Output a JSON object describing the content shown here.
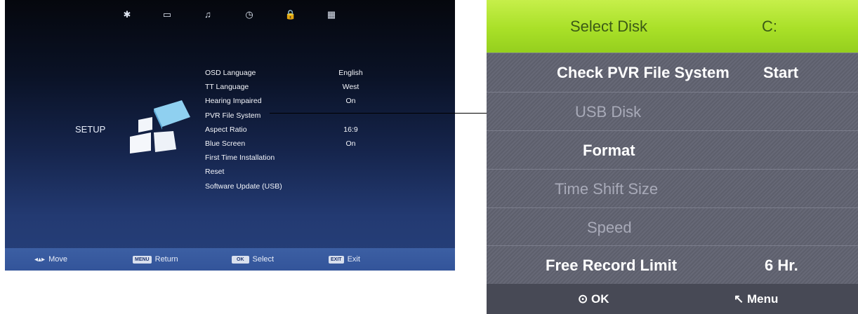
{
  "tv": {
    "top_icons": [
      {
        "name": "settings-gear-icon",
        "glyph": "✱"
      },
      {
        "name": "display-monitor-icon",
        "glyph": "▭"
      },
      {
        "name": "music-note-icon",
        "glyph": "♫"
      },
      {
        "name": "clock-icon",
        "glyph": "◷"
      },
      {
        "name": "lock-icon",
        "glyph": "🔒"
      },
      {
        "name": "grid-app-icon",
        "glyph": "▦"
      }
    ],
    "section_label": "SETUP",
    "menu": [
      {
        "label": "OSD Language",
        "value": "English"
      },
      {
        "label": "TT Language",
        "value": "West"
      },
      {
        "label": "Hearing Impaired",
        "value": "On"
      },
      {
        "label": "PVR File System",
        "value": ""
      },
      {
        "label": "Aspect Ratio",
        "value": "16:9"
      },
      {
        "label": "Blue Screen",
        "value": "On"
      },
      {
        "label": "First Time Installation",
        "value": ""
      },
      {
        "label": "Reset",
        "value": ""
      },
      {
        "label": "Software Update (USB)",
        "value": ""
      }
    ],
    "hints": {
      "move": "Move",
      "menu_key": "MENU",
      "return": "Return",
      "ok_key": "OK",
      "select": "Select",
      "exit_key": "EXIT",
      "exit": "Exit"
    }
  },
  "pvr": {
    "select_disk": {
      "label": "Select Disk",
      "value": "C:"
    },
    "rows": [
      {
        "label": "Check PVR File System",
        "value": "Start",
        "enabled": true
      },
      {
        "label": "USB Disk",
        "value": "",
        "enabled": false
      },
      {
        "label": "Format",
        "value": "",
        "enabled": true
      },
      {
        "label": "Time Shift Size",
        "value": "",
        "enabled": false
      },
      {
        "label": "Speed",
        "value": "",
        "enabled": false
      },
      {
        "label": "Free Record Limit",
        "value": "6 Hr.",
        "enabled": true
      }
    ],
    "hints": {
      "ok": "OK",
      "menu": "Menu"
    }
  },
  "colors": {
    "highlight": "#a9e028",
    "tv_bar": "#3c5fa3"
  }
}
